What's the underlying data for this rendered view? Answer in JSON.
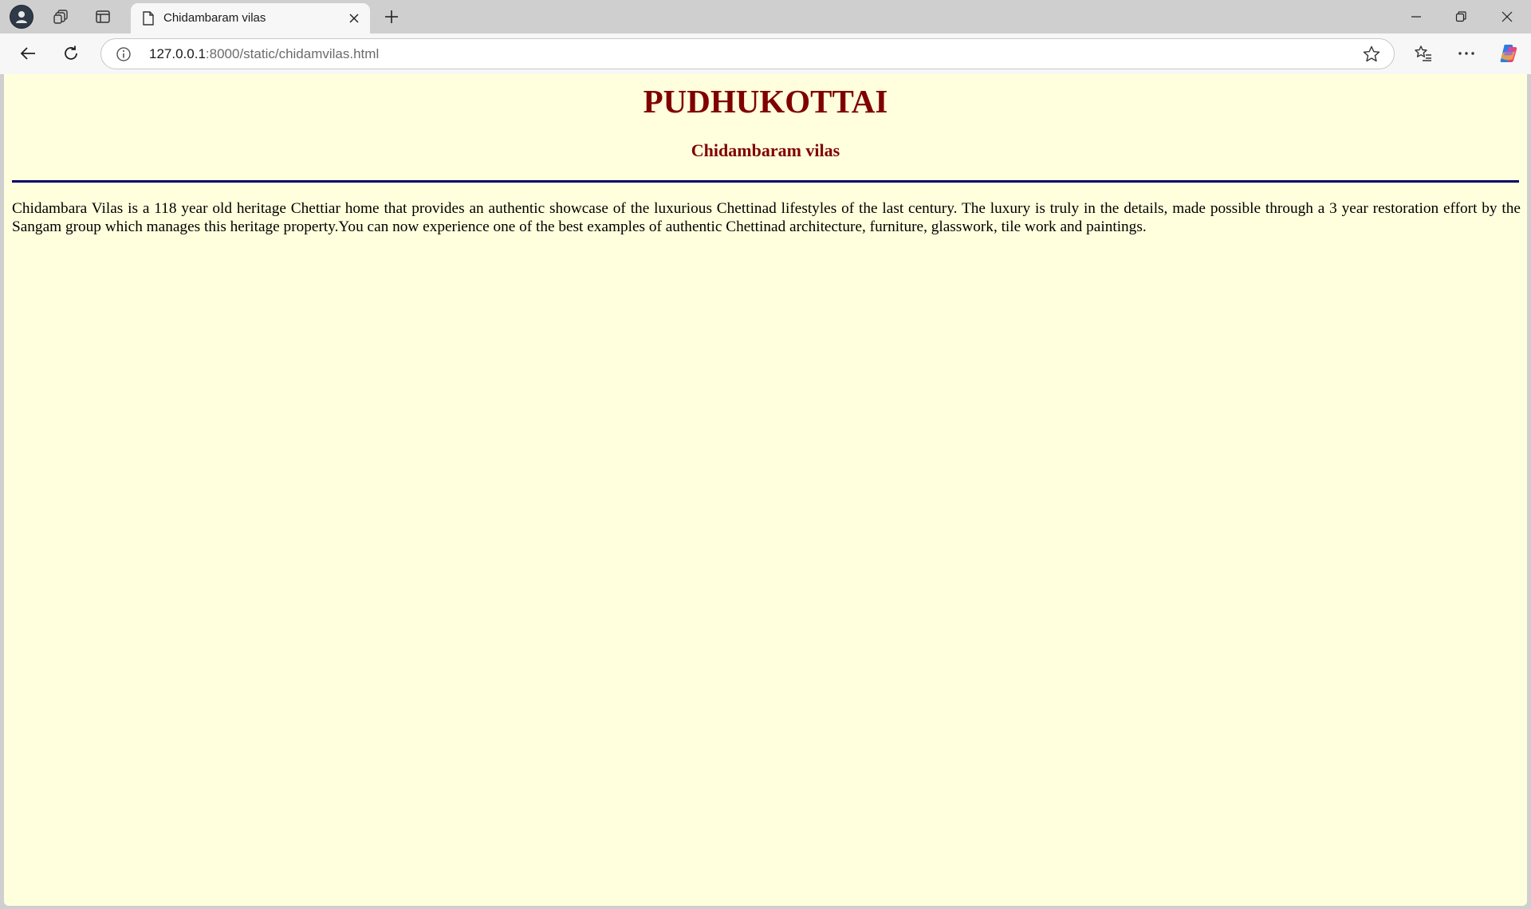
{
  "browser": {
    "tab": {
      "title": "Chidambaram vilas"
    },
    "address": {
      "host": "127.0.0.1",
      "rest": ":8000/static/chidamvilas.html"
    },
    "icons": {
      "profile": "profile-avatar-icon",
      "collections": "collections-icon",
      "vertical_tabs": "vertical-tabs-icon",
      "page": "page-icon",
      "close_tab": "close-icon",
      "new_tab": "plus-icon",
      "back": "back-arrow-icon",
      "refresh": "refresh-icon",
      "info": "info-icon",
      "favorite": "star-icon",
      "favorites": "favorites-list-icon",
      "more": "more-icon",
      "copilot": "copilot-icon",
      "minimize": "minimize-icon",
      "restore": "restore-icon",
      "close_window": "close-icon"
    }
  },
  "page": {
    "heading": "PUDHUKOTTAI",
    "subheading": "Chidambaram vilas",
    "paragraph": "Chidambara Vilas is a 118 year old heritage Chettiar home that provides an authentic showcase of the luxurious Chettinad lifestyles of the last century. The luxury is truly in the details, made possible through a 3 year restoration effort by the Sangam group which manages this heritage property.You can now experience one of the best examples of authentic Chettinad architecture, furniture, glasswork, tile work and paintings."
  },
  "colors": {
    "page_background": "#ffffdd",
    "heading": "#800000",
    "rule": "#000066",
    "text": "#000000"
  }
}
